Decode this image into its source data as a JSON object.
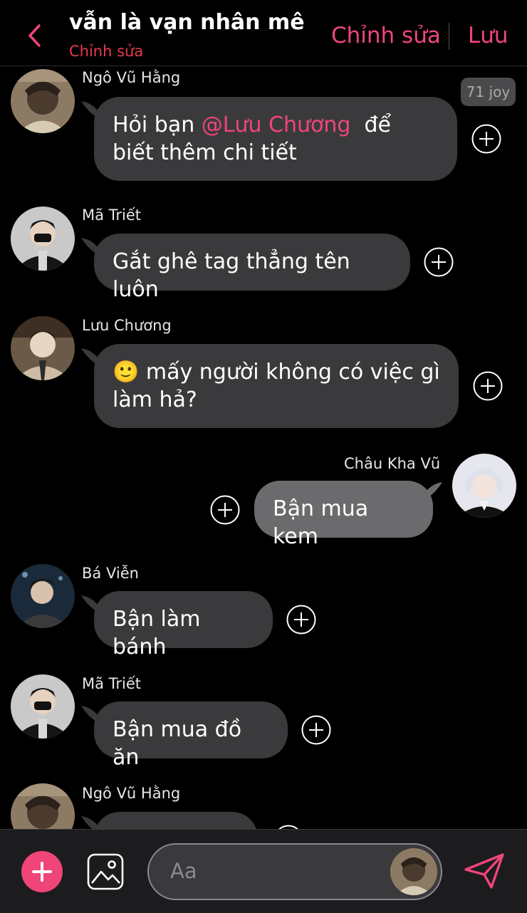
{
  "header": {
    "title": "vẫn là vạn nhân mê",
    "subtitle": "Chỉnh sửa",
    "edit_label": "Chỉnh sửa",
    "save_label": "Lưu",
    "back_icon": "chevron-left-icon"
  },
  "badge": {
    "text": "71 joy"
  },
  "messages": [
    {
      "sender": "Ngô Vũ Hằng",
      "text_before": "Hỏi bạn ",
      "mention": "@Lưu Chương",
      "text_after": "  để biết thêm chi tiết"
    },
    {
      "sender": "Mã Triết",
      "text": "Gắt ghê tag thẳng tên luôn"
    },
    {
      "sender": "Lưu Chương",
      "emoji": "🙂",
      "text": " mấy người không có việc gì làm hả?"
    },
    {
      "sender": "Châu Kha Vũ",
      "text": "Bận mua kem"
    },
    {
      "sender": "Bá Viễn",
      "text": "Bận làm bánh"
    },
    {
      "sender": "Mã Triết",
      "text": "Bận mua đồ ăn"
    },
    {
      "sender": "Ngô Vũ Hằng",
      "text": ""
    }
  ],
  "composer": {
    "placeholder": "Aa"
  },
  "colors": {
    "accent": "#f0457a",
    "subtitle": "#e8394d",
    "bubble": "#3a3a3c",
    "my_bubble": "#6b6b6e",
    "background": "#000000"
  }
}
